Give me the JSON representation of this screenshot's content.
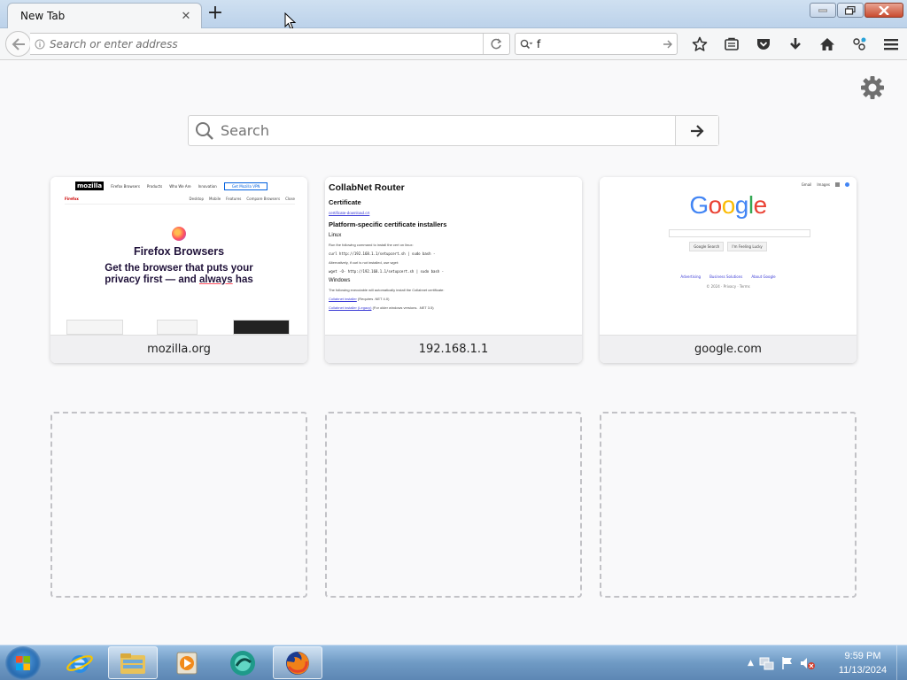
{
  "browser": {
    "tab": {
      "title": "New Tab",
      "close_icon": "close-icon"
    },
    "new_tab_icon": "plus-icon",
    "url_bar": {
      "placeholder": "Search or enter address",
      "value": ""
    },
    "search_bar": {
      "value": "f"
    },
    "toolbar_icons": [
      "bookmark-star-icon",
      "reading-list-icon",
      "pocket-icon",
      "download-icon",
      "home-icon",
      "extension-icon",
      "menu-icon"
    ]
  },
  "newtab": {
    "search": {
      "placeholder": "Search"
    },
    "tiles": [
      {
        "label": "mozilla.org",
        "thumb": {
          "logo": "mozilla",
          "nav": [
            "Firefox Browsers",
            "Products",
            "Who We Are",
            "Innovation"
          ],
          "cta": "Get Mozilla VPN",
          "sub_left": "Firefox",
          "sub_links": [
            "Desktop",
            "Mobile",
            "Features",
            "Compare Browsers",
            "Close"
          ],
          "title": "Firefox Browsers",
          "tagline_1": "Get the browser that puts your",
          "tagline_2a": "privacy first — and ",
          "tagline_2b": "always",
          "tagline_2c": " has"
        }
      },
      {
        "label": "192.168.1.1",
        "thumb": {
          "title": "CollabNet Router",
          "section": "Certificate",
          "cert_link": "certificate-download.crt",
          "platform": "Platform-specific certificate installers",
          "linux": "Linux",
          "linux_p": "Run the following command to install the cert on linux:",
          "linux_c": "curl http://192.168.1.1/setupcert.sh | sudo bash -",
          "alt_p": "Alternatively, if curl is not installed, use wget:",
          "alt_c": "wget -O- http://192.168.1.1/setupcert.sh | sudo bash -",
          "windows": "Windows",
          "win_p": "The following executable will automatically install the Collabnet certificate:",
          "win_l1": "Collabnet installer",
          "win_l1b": " (Requires .NET 4.0)",
          "win_l2": "Collabnet installer (Legacy)",
          "win_l2b": " (For older windows versions. .NET 3.5)"
        }
      },
      {
        "label": "google.com",
        "thumb": {
          "top_links": [
            "Gmail",
            "Images"
          ],
          "logo": "Google",
          "btn1": "Google Search",
          "btn2": "I'm Feeling Lucky",
          "links": [
            "Advertising",
            "Business Solutions",
            "About Google"
          ],
          "foot": "© 2024 · Privacy · Terms"
        }
      }
    ]
  },
  "taskbar": {
    "apps": [
      "internet-explorer",
      "windows-explorer",
      "media-player",
      "app-circle",
      "firefox"
    ],
    "clock": {
      "time": "9:59 PM",
      "date": "11/13/2024"
    }
  },
  "colors": {
    "accent": "#0060df",
    "google_blue": "#4285f4",
    "google_red": "#ea4335",
    "google_yellow": "#fbbc05",
    "google_green": "#34a853"
  }
}
